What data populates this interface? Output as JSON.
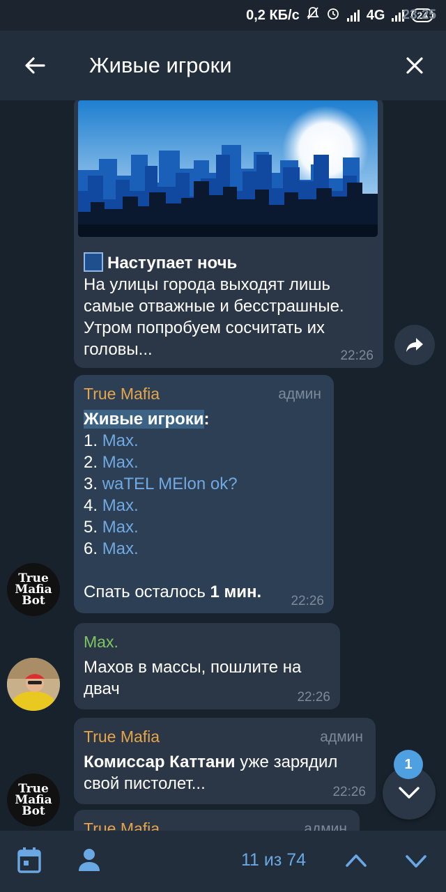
{
  "status": {
    "time": "23:25",
    "speed": "0,2 КБ/с",
    "network": "4G",
    "battery": "24"
  },
  "header": {
    "title": "Живые игроки"
  },
  "messages": {
    "night": {
      "heading": "Наступает ночь",
      "body": "На улицы города выходят лишь самые отважные и бесстрашные. Утром попробуем сосчитать их головы...",
      "time": "22:26"
    },
    "players": {
      "sender": "True Mafia",
      "role": "админ",
      "title": "Живые игроки",
      "colon": ":",
      "items": [
        {
          "n": "1.",
          "name": "Max."
        },
        {
          "n": "2.",
          "name": "Max."
        },
        {
          "n": "3.",
          "name": "waTEL MElon ok?"
        },
        {
          "n": "4.",
          "name": "Max."
        },
        {
          "n": "5.",
          "name": "Max."
        },
        {
          "n": "6.",
          "name": "Max."
        }
      ],
      "sleep_prefix": "Спать осталось ",
      "sleep_value": "1 мин.",
      "time": "22:26"
    },
    "max_msg": {
      "sender": "Max.",
      "text": "Махов в массы, пошлите на двач",
      "time": "22:26"
    },
    "commissar": {
      "sender": "True Mafia",
      "role": "админ",
      "bold": "Комиссар Каттани",
      "rest": " уже зарядил свой пистолет...",
      "time": "22:26"
    },
    "partial": {
      "sender": "True Mafia",
      "role": "админ"
    }
  },
  "avatar_logo": [
    "True",
    "Mafia",
    "Bot"
  ],
  "unread_badge": "1",
  "search": {
    "counter": "11 из 74"
  },
  "colors": {
    "background": "#18222d",
    "bubble": "#2b3646",
    "accent": "#6aa8e4",
    "sender": "#e6a54a",
    "sender_alt": "#7bc862"
  },
  "icons": [
    "back-arrow-icon",
    "close-icon",
    "share-icon",
    "chevron-down-icon",
    "calendar-icon",
    "person-icon",
    "chevron-up-icon"
  ]
}
